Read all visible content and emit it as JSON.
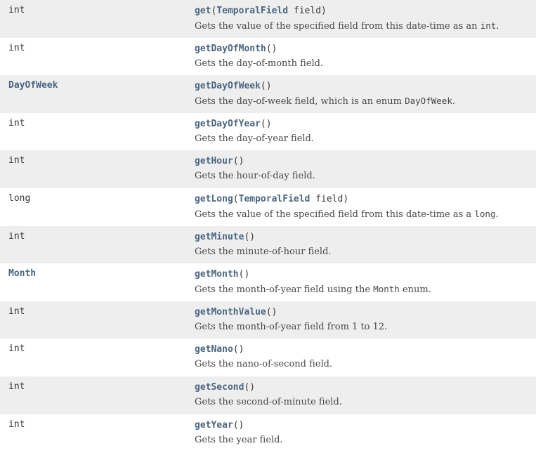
{
  "rows": [
    {
      "type": "int",
      "type_link": false,
      "method": "get",
      "param_type": "TemporalField",
      "param_name": "field",
      "desc_pre": "Gets the value of the specified field from this date-time as an ",
      "desc_code": "int",
      "desc_post": "."
    },
    {
      "type": "int",
      "type_link": false,
      "method": "getDayOfMonth",
      "param_type": "",
      "param_name": "",
      "desc_pre": "Gets the day-of-month field.",
      "desc_code": "",
      "desc_post": ""
    },
    {
      "type": "DayOfWeek",
      "type_link": true,
      "method": "getDayOfWeek",
      "param_type": "",
      "param_name": "",
      "desc_pre": "Gets the day-of-week field, which is an enum ",
      "desc_code": "DayOfWeek",
      "desc_post": "."
    },
    {
      "type": "int",
      "type_link": false,
      "method": "getDayOfYear",
      "param_type": "",
      "param_name": "",
      "desc_pre": "Gets the day-of-year field.",
      "desc_code": "",
      "desc_post": ""
    },
    {
      "type": "int",
      "type_link": false,
      "method": "getHour",
      "param_type": "",
      "param_name": "",
      "desc_pre": "Gets the hour-of-day field.",
      "desc_code": "",
      "desc_post": ""
    },
    {
      "type": "long",
      "type_link": false,
      "method": "getLong",
      "param_type": "TemporalField",
      "param_name": "field",
      "desc_pre": "Gets the value of the specified field from this date-time as a ",
      "desc_code": "long",
      "desc_post": "."
    },
    {
      "type": "int",
      "type_link": false,
      "method": "getMinute",
      "param_type": "",
      "param_name": "",
      "desc_pre": "Gets the minute-of-hour field.",
      "desc_code": "",
      "desc_post": ""
    },
    {
      "type": "Month",
      "type_link": true,
      "method": "getMonth",
      "param_type": "",
      "param_name": "",
      "desc_pre": "Gets the month-of-year field using the ",
      "desc_code": "Month",
      "desc_post": " enum."
    },
    {
      "type": "int",
      "type_link": false,
      "method": "getMonthValue",
      "param_type": "",
      "param_name": "",
      "desc_pre": "Gets the month-of-year field from 1 to 12.",
      "desc_code": "",
      "desc_post": ""
    },
    {
      "type": "int",
      "type_link": false,
      "method": "getNano",
      "param_type": "",
      "param_name": "",
      "desc_pre": "Gets the nano-of-second field.",
      "desc_code": "",
      "desc_post": ""
    },
    {
      "type": "int",
      "type_link": false,
      "method": "getSecond",
      "param_type": "",
      "param_name": "",
      "desc_pre": "Gets the second-of-minute field.",
      "desc_code": "",
      "desc_post": ""
    },
    {
      "type": "int",
      "type_link": false,
      "method": "getYear",
      "param_type": "",
      "param_name": "",
      "desc_pre": "Gets the year field.",
      "desc_code": "",
      "desc_post": ""
    }
  ],
  "colors": {
    "link": "#4a6782",
    "alt_row": "#eeeeef",
    "text": "#474747"
  }
}
